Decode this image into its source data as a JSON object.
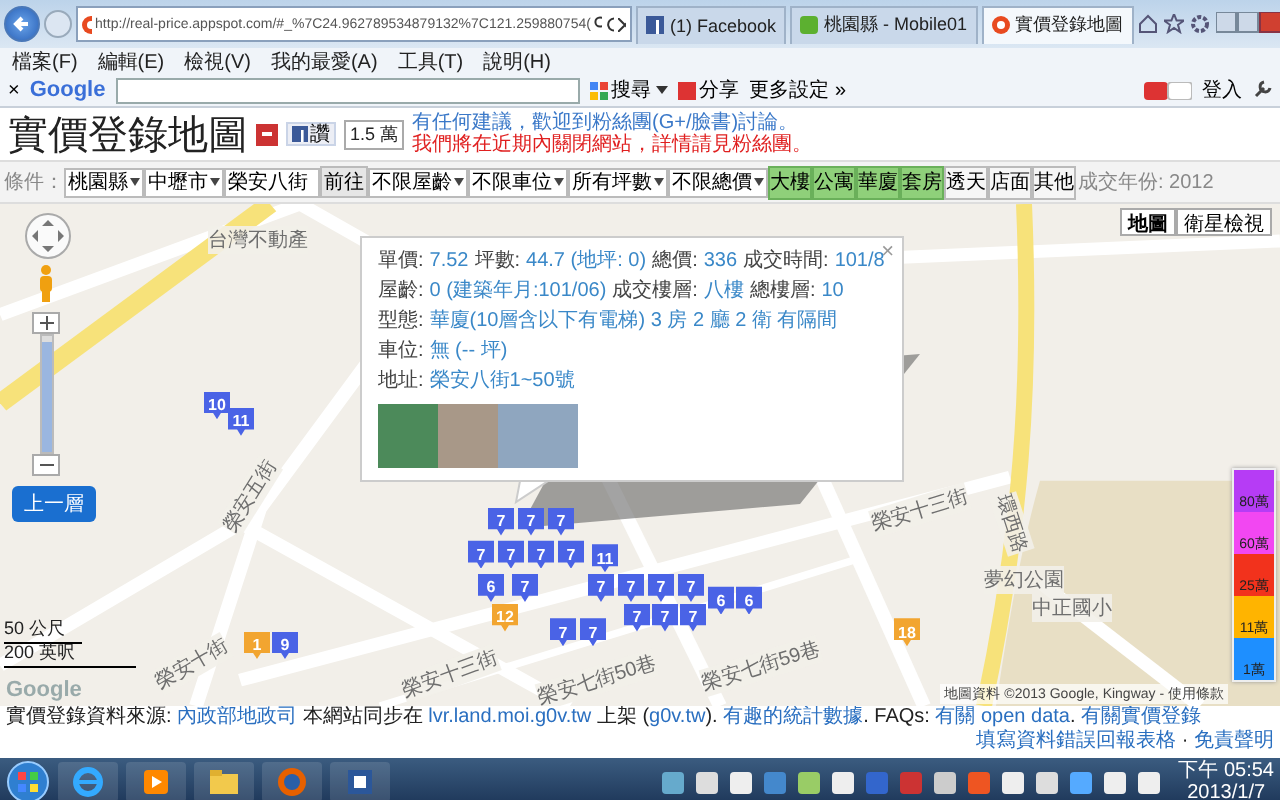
{
  "browser": {
    "url": "http://real-price.appspot.com/#_%7C24.962789534879132%7C121.259880754(",
    "tabs": [
      {
        "title": "(1) Facebook",
        "kind": "facebook",
        "selected": false
      },
      {
        "title": "桃園縣 - Mobile01",
        "kind": "mobile01",
        "selected": false
      },
      {
        "title": "實價登錄地圖",
        "kind": "site",
        "selected": true
      }
    ],
    "menu": [
      "檔案(F)",
      "編輯(E)",
      "檢視(V)",
      "我的最愛(A)",
      "工具(T)",
      "說明(H)"
    ]
  },
  "google_toolbar": {
    "close": "×",
    "logo": "Google",
    "search_button": "搜尋",
    "share": "分享",
    "more": "更多設定",
    "more_icon": "»",
    "sign_in": "登入"
  },
  "header": {
    "title": "實價登錄地圖",
    "like": "讚",
    "like_count": "1.5 萬",
    "notice": "有任何建議，歡迎到粉絲團(G+/臉書)討論。",
    "warning": "我們將在近期內關閉網站，詳情請見粉絲團。"
  },
  "filters": {
    "label": "條件：",
    "selects": [
      "桃園縣",
      "中壢市"
    ],
    "address": "榮安八街",
    "go": "前往",
    "range_selects": [
      "不限屋齡",
      "不限車位",
      "所有坪數",
      "不限總價"
    ],
    "types": [
      {
        "label": "大樓",
        "selected": true
      },
      {
        "label": "公寓",
        "selected": true
      },
      {
        "label": "華廈",
        "selected": true
      },
      {
        "label": "套房",
        "selected": true
      },
      {
        "label": "透天",
        "selected": false
      },
      {
        "label": "店面",
        "selected": false
      },
      {
        "label": "其他",
        "selected": false
      }
    ],
    "year": "成交年份: 2012"
  },
  "map": {
    "map_types": [
      {
        "label": "地圖",
        "selected": true
      },
      {
        "label": "衛星檢視",
        "selected": false
      }
    ],
    "zoom": {
      "level": 0.95
    },
    "up_button": "上一層",
    "scale": [
      "50 公尺",
      "200 英呎"
    ],
    "logo": "Google",
    "copyright": "地圖資料 ©2013 Google, Kingway - 使用條款",
    "streets": [
      {
        "text": "台灣不動產"
      },
      {
        "text": "榮安五街"
      },
      {
        "text": "榮安十街"
      },
      {
        "text": "榮安十三街"
      },
      {
        "text": "榮安十三街"
      },
      {
        "text": "榮安七街59巷"
      },
      {
        "text": "榮安七街50巷"
      },
      {
        "text": "環西路"
      },
      {
        "text": "夢幻公園"
      },
      {
        "text": "中正國小"
      }
    ],
    "markers": [
      {
        "label": "10",
        "color": "#4a63e6"
      },
      {
        "label": "11",
        "color": "#4a63e6"
      },
      {
        "label": "7",
        "color": "#4a63e6"
      },
      {
        "label": "7",
        "color": "#4a63e6"
      },
      {
        "label": "7",
        "color": "#4a63e6"
      },
      {
        "label": "7",
        "color": "#4a63e6"
      },
      {
        "label": "7",
        "color": "#4a63e6"
      },
      {
        "label": "7",
        "color": "#4a63e6"
      },
      {
        "label": "7",
        "color": "#4a63e6"
      },
      {
        "label": "11",
        "color": "#4a63e6"
      },
      {
        "label": "6",
        "color": "#4a63e6"
      },
      {
        "label": "7",
        "color": "#4a63e6"
      },
      {
        "label": "7",
        "color": "#4a63e6"
      },
      {
        "label": "7",
        "color": "#4a63e6"
      },
      {
        "label": "7",
        "color": "#4a63e6"
      },
      {
        "label": "7",
        "color": "#4a63e6"
      },
      {
        "label": "6",
        "color": "#4a63e6"
      },
      {
        "label": "6",
        "color": "#4a63e6"
      },
      {
        "label": "12",
        "color": "#f2a530"
      },
      {
        "label": "7",
        "color": "#4a63e6"
      },
      {
        "label": "7",
        "color": "#4a63e6"
      },
      {
        "label": "7",
        "color": "#4a63e6"
      },
      {
        "label": "7",
        "color": "#4a63e6"
      },
      {
        "label": "7",
        "color": "#4a63e6"
      },
      {
        "label": "18",
        "color": "#f2a530"
      },
      {
        "label": "1",
        "color": "#f2a530"
      },
      {
        "label": "9",
        "color": "#4a63e6"
      }
    ],
    "popup": {
      "close": "×",
      "lines": [
        [
          {
            "label": "單價:",
            "value": "7.52"
          },
          {
            "label": "坪數:",
            "value": "44.7 (地坪: 0)"
          },
          {
            "label": "總價:",
            "value": "336"
          },
          {
            "label": "成交時間:",
            "value": "101/8"
          }
        ],
        [
          {
            "label": "屋齡:",
            "value": "0 (建築年月:101/06)"
          },
          {
            "label": "成交樓層:",
            "value": "八樓"
          },
          {
            "label": "總樓層:",
            "value": "10"
          }
        ],
        [
          {
            "label": "型態:",
            "value": "華廈(10層含以下有電梯) 3 房 2 廳 2 衛 有隔間"
          }
        ],
        [
          {
            "label": "車位:",
            "value": "無 (-- 坪)"
          }
        ],
        [
          {
            "label": "地址:",
            "value": "榮安八街1~50號"
          }
        ]
      ]
    },
    "legend": [
      {
        "label": "80萬",
        "color": "#b63cf5"
      },
      {
        "label": "60萬",
        "color": "#f247f2"
      },
      {
        "label": "25萬",
        "color": "#f2321c"
      },
      {
        "label": "11萬",
        "color": "#ffb400"
      },
      {
        "label": "1萬",
        "color": "#1e8fff"
      }
    ]
  },
  "footer": {
    "left": [
      {
        "text": "實價登錄資料來源: ",
        "link": false
      },
      {
        "text": "內政部地政司",
        "link": true
      },
      {
        "text": " 本網站同步在 ",
        "link": false
      },
      {
        "text": "lvr.land.moi.g0v.tw",
        "link": true
      },
      {
        "text": " 上架 (",
        "link": false
      },
      {
        "text": "g0v.tw",
        "link": true
      },
      {
        "text": "). ",
        "link": false
      },
      {
        "text": "有趣的統計數據",
        "link": true
      },
      {
        "text": ". FAQs: ",
        "link": false
      },
      {
        "text": "有關 open data",
        "link": true
      },
      {
        "text": ". ",
        "link": false
      },
      {
        "text": "有關實價登錄",
        "link": true
      }
    ],
    "right": [
      {
        "text": "填寫資料錯誤回報表格",
        "link": true
      },
      {
        "text": " · ",
        "link": false
      },
      {
        "text": "免責聲明",
        "link": true
      }
    ]
  },
  "taskbar": {
    "time": "下午 05:54",
    "date": "2013/1/7"
  }
}
